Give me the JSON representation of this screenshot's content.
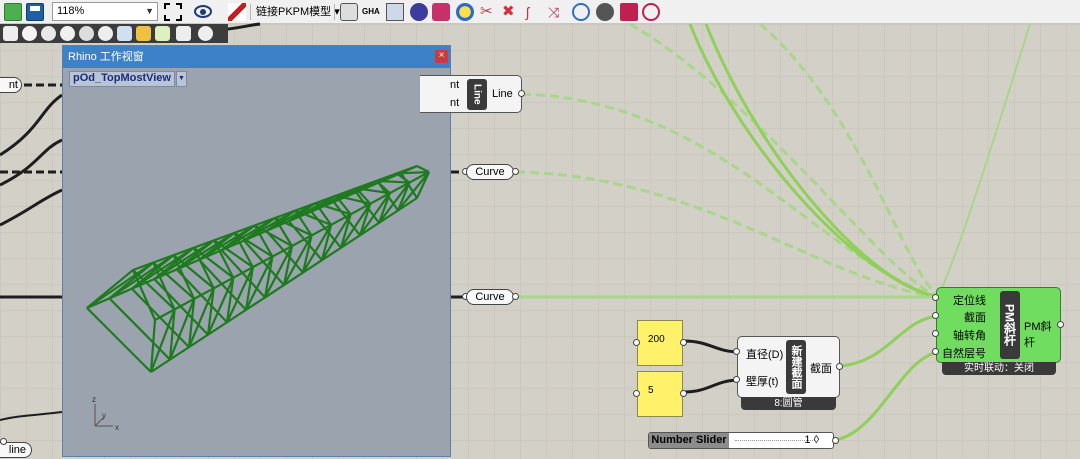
{
  "toolbar": {
    "zoom_value": "118%",
    "pkpm_menu": "链接PKPM模型",
    "pkpm_arrow": "▾"
  },
  "rhino_window": {
    "title": "Rhino 工作视窗",
    "close": "×",
    "viewport_name": "pOd_TopMostView",
    "axis_x": "x",
    "axis_y": "y",
    "axis_z": "z"
  },
  "components": {
    "left_stub_top": "nt",
    "left_stub_mid": "",
    "left_stub_bottom": "line",
    "line_node": {
      "input1": "nt",
      "input2": "nt",
      "name": "Line",
      "output": "Line"
    },
    "curve_param_1": "Curve",
    "curve_param_2": "Curve",
    "panel_diameter": "200",
    "panel_thickness": "5",
    "section_component": {
      "input_diameter": "直径(D)",
      "input_thickness": "壁厚(t)",
      "name": "新建截面",
      "output": "截面",
      "caption": "8:圆管"
    },
    "pm_component": {
      "inputs": [
        "定位线",
        "截面",
        "轴转角",
        "自然层号"
      ],
      "name": "PM斜杆",
      "output": "PM斜杆",
      "caption": "实时联动：关闭"
    },
    "number_slider": {
      "name": "Number Slider",
      "value": "1 ◊"
    }
  },
  "colors": {
    "wire_green": "#8fcf5a",
    "truss_green": "#1f7a1f",
    "rhino_title_blue": "#3d82c8",
    "panel_yellow": "#fff26a"
  }
}
